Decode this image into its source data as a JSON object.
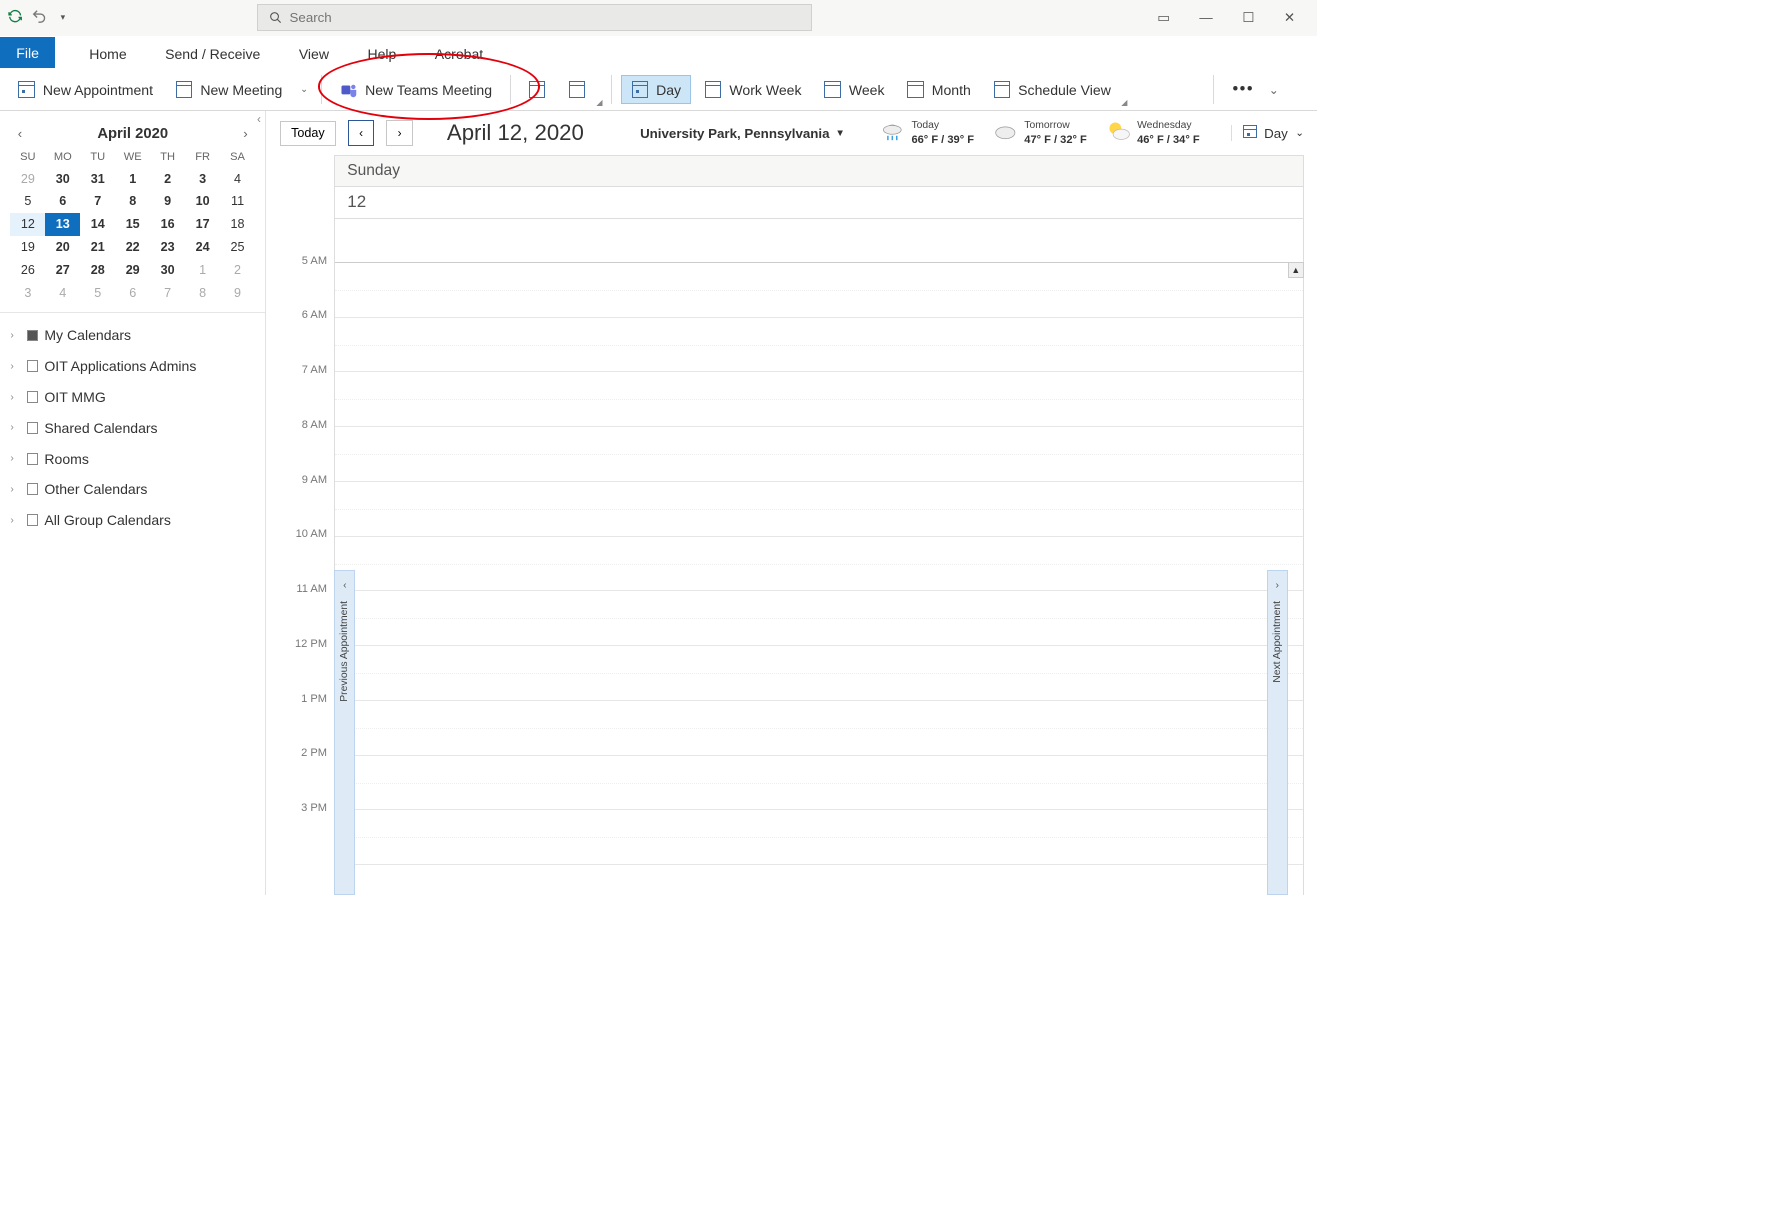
{
  "search": {
    "placeholder": "Search"
  },
  "tabs": {
    "file": "File",
    "home": "Home",
    "sendreceive": "Send / Receive",
    "view": "View",
    "help": "Help",
    "acrobat": "Acrobat"
  },
  "ribbon": {
    "new_appointment": "New Appointment",
    "new_meeting": "New Meeting",
    "new_teams_meeting": "New Teams Meeting",
    "day": "Day",
    "work_week": "Work Week",
    "week": "Week",
    "month": "Month",
    "schedule_view": "Schedule View"
  },
  "mini_cal": {
    "title": "April 2020",
    "dow": [
      "SU",
      "MO",
      "TU",
      "WE",
      "TH",
      "FR",
      "SA"
    ],
    "cells": [
      {
        "n": "29",
        "dim": true
      },
      {
        "n": "30",
        "b": true
      },
      {
        "n": "31",
        "b": true
      },
      {
        "n": "1",
        "b": true
      },
      {
        "n": "2",
        "b": true
      },
      {
        "n": "3",
        "b": true
      },
      {
        "n": "4"
      },
      {
        "n": "5"
      },
      {
        "n": "6",
        "b": true
      },
      {
        "n": "7",
        "b": true
      },
      {
        "n": "8",
        "b": true
      },
      {
        "n": "9",
        "b": true
      },
      {
        "n": "10",
        "b": true
      },
      {
        "n": "11"
      },
      {
        "n": "12",
        "pick": true
      },
      {
        "n": "13",
        "today": true
      },
      {
        "n": "14",
        "b": true
      },
      {
        "n": "15",
        "b": true
      },
      {
        "n": "16",
        "b": true
      },
      {
        "n": "17",
        "b": true
      },
      {
        "n": "18"
      },
      {
        "n": "19"
      },
      {
        "n": "20",
        "b": true
      },
      {
        "n": "21",
        "b": true
      },
      {
        "n": "22",
        "b": true
      },
      {
        "n": "23",
        "b": true
      },
      {
        "n": "24",
        "b": true
      },
      {
        "n": "25"
      },
      {
        "n": "26"
      },
      {
        "n": "27",
        "b": true
      },
      {
        "n": "28",
        "b": true
      },
      {
        "n": "29",
        "b": true
      },
      {
        "n": "30",
        "b": true
      },
      {
        "n": "1",
        "dim": true
      },
      {
        "n": "2",
        "dim": true
      },
      {
        "n": "3",
        "dim": true
      },
      {
        "n": "4",
        "dim": true
      },
      {
        "n": "5",
        "dim": true
      },
      {
        "n": "6",
        "dim": true
      },
      {
        "n": "7",
        "dim": true
      },
      {
        "n": "8",
        "dim": true
      },
      {
        "n": "9",
        "dim": true
      }
    ]
  },
  "cal_groups": [
    {
      "label": "My Calendars",
      "checked": true
    },
    {
      "label": "OIT Applications Admins",
      "checked": false
    },
    {
      "label": "OIT MMG",
      "checked": false
    },
    {
      "label": "Shared Calendars",
      "checked": false
    },
    {
      "label": "Rooms",
      "checked": false
    },
    {
      "label": "Other Calendars",
      "checked": false
    },
    {
      "label": "All Group Calendars",
      "checked": false
    }
  ],
  "toolbar": {
    "today": "Today",
    "date_title": "April 12, 2020",
    "location": "University Park, Pennsylvania",
    "view_label": "Day"
  },
  "weather": [
    {
      "label": "Today",
      "temp": "66° F / 39° F",
      "icon": "rain"
    },
    {
      "label": "Tomorrow",
      "temp": "47° F / 32° F",
      "icon": "cloud"
    },
    {
      "label": "Wednesday",
      "temp": "46° F / 34° F",
      "icon": "sun"
    }
  ],
  "day_view": {
    "weekday": "Sunday",
    "day_num": "12",
    "hours": [
      "5 AM",
      "6 AM",
      "7 AM",
      "8 AM",
      "9 AM",
      "10 AM",
      "11 AM",
      "12 PM",
      "1 PM",
      "2 PM",
      "3 PM"
    ]
  },
  "handles": {
    "prev": "Previous Appointment",
    "next": "Next Appointment"
  }
}
